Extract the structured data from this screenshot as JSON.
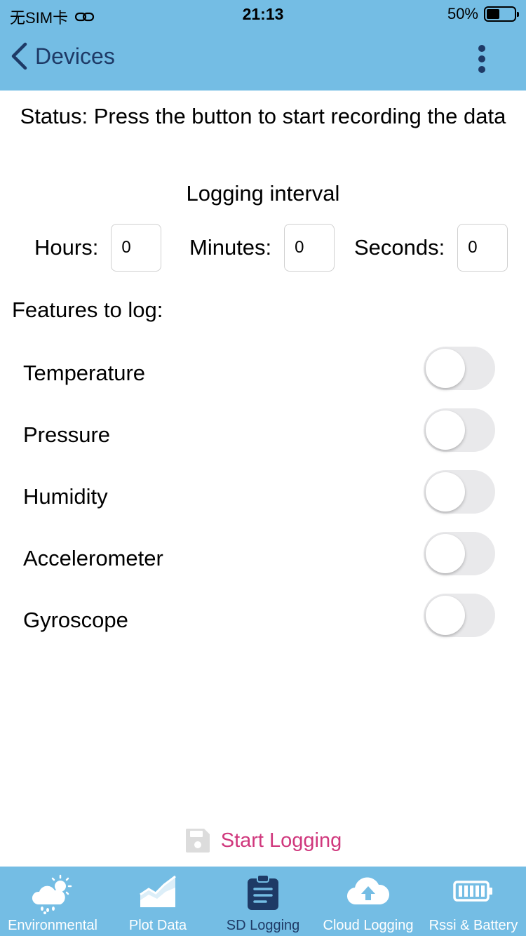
{
  "status_bar": {
    "carrier": "无SIM卡",
    "time": "21:13",
    "battery": "50%"
  },
  "nav": {
    "back_label": "Devices"
  },
  "content": {
    "status": "Status: Press the button to start recording the data",
    "interval_title": "Logging interval",
    "hours_label": "Hours:",
    "hours_value": "0",
    "minutes_label": "Minutes:",
    "minutes_value": "0",
    "seconds_label": "Seconds:",
    "seconds_value": "0",
    "features_title": "Features to log:",
    "features": [
      {
        "label": "Temperature",
        "enabled": false
      },
      {
        "label": "Pressure",
        "enabled": false
      },
      {
        "label": "Humidity",
        "enabled": false
      },
      {
        "label": "Accelerometer",
        "enabled": false
      },
      {
        "label": "Gyroscope",
        "enabled": false
      }
    ],
    "start_button": "Start Logging"
  },
  "tabs": [
    {
      "label": "Environmental",
      "icon": "weather-icon",
      "active": false
    },
    {
      "label": "Plot Data",
      "icon": "chart-icon",
      "active": false
    },
    {
      "label": "SD Logging",
      "icon": "clipboard-icon",
      "active": true
    },
    {
      "label": "Cloud Logging",
      "icon": "cloud-upload-icon",
      "active": false
    },
    {
      "label": "Rssi & Battery",
      "icon": "battery-icon",
      "active": false
    }
  ],
  "colors": {
    "bar_background": "#74BDE4",
    "nav_text": "#1E3A66",
    "start_button_text": "#D0387D",
    "toggle_off": "#E9E9EB"
  }
}
